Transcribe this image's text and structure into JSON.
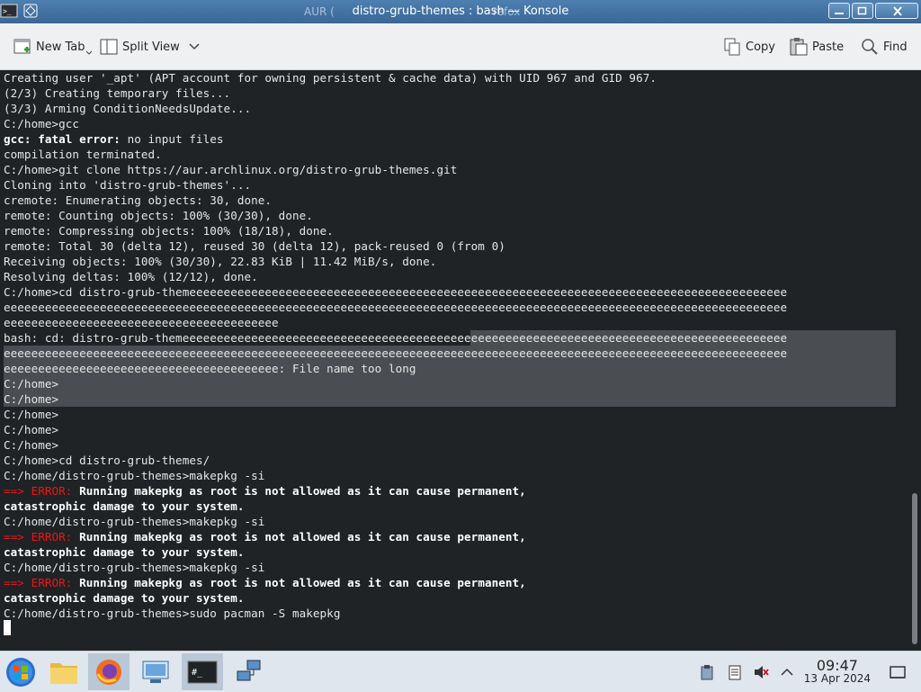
{
  "window": {
    "title": "distro-grub-themes : bash — Konsole",
    "ghost_title_left": "AUR (",
    "ghost_title_right": "refox"
  },
  "toolbar": {
    "new_tab": "New Tab",
    "split_view": "Split View",
    "copy": "Copy",
    "paste": "Paste",
    "find": "Find"
  },
  "terminal": {
    "l01": "Creating user '_apt' (APT account for owning persistent & cache data) with UID 967 and GID 967.",
    "l02": "(2/3) Creating temporary files...",
    "l03": "(3/3) Arming ConditionNeedsUpdate...",
    "l04": "C:/home>gcc",
    "l05_a": "gcc:",
    "l05_b": " fatal error:",
    "l05_c": " no input files",
    "l06": "compilation terminated.",
    "l07": "C:/home>git clone https://aur.archlinux.org/distro-grub-themes.git",
    "l08": "Cloning into 'distro-grub-themes'...",
    "l09": "cremote: Enumerating objects: 30, done.",
    "l10": "remote: Counting objects: 100% (30/30), done.",
    "l11": "remote: Compressing objects: 100% (18/18), done.",
    "l12": "remote: Total 30 (delta 12), reused 30 (delta 12), pack-reused 0 (from 0)",
    "l13": "Receiving objects: 100% (30/30), 22.83 KiB | 11.42 MiB/s, done.",
    "l14": "Resolving deltas: 100% (12/12), done.",
    "l15": "C:/home>cd distro-grub-themeeeeeeeeeeeeeeeeeeeeeeeeeeeeeeeeeeeeeeeeeeeeeeeeeeeeeeeeeeeeeeeeeeeeeeeeeeeeeeeeeeeeeee",
    "l16": "eeeeeeeeeeeeeeeeeeeeeeeeeeeeeeeeeeeeeeeeeeeeeeeeeeeeeeeeeeeeeeeeeeeeeeeeeeeeeeeeeeeeeeeeeeeeeeeeeeeeeeeeeeeeeeeeee",
    "l17": "eeeeeeeeeeeeeeeeeeeeeeeeeeeeeeeeeeeeeeee",
    "l18": "bash: cd: distro-grub-themeeeeeeeeeeeeeeeeeeeeeeeeeeeeeeeeeeeeeeeeeeeeeeeeeeeeeeeeeeeeeeeeeeeeeeeeeeeeeeeeeeeeeeee",
    "l19": "eeeeeeeeeeeeeeeeeeeeeeeeeeeeeeeeeeeeeeeeeeeeeeeeeeeeeeeeeeeeeeeeeeeeeeeeeeeeeeeeeeeeeeeeeeeeeeeeeeeeeeeeeeeeeeeeee",
    "l20": "eeeeeeeeeeeeeeeeeeeeeeeeeeeeeeeeeeeeeeee: File name too long",
    "l21": "C:/home>",
    "l22": "C:/home>",
    "l23": "C:/home>",
    "l24": "C:/home>",
    "l25": "C:/home>",
    "l26": "C:/home>cd distro-grub-themes/",
    "l27": "C:/home/distro-grub-themes>makepkg -si",
    "err_arrow": "==>",
    "err_label": " ERROR:",
    "err_msg": " Running makepkg as root is not allowed as it can cause permanent,",
    "err_msg2": "catastrophic damage to your system.",
    "l30": "C:/home/distro-grub-themes>makepkg -si",
    "l33": "C:/home/distro-grub-themes>makepkg -si",
    "l36": "C:/home/distro-grub-themes>sudo pacman -S makepkg"
  },
  "taskbar": {
    "time": "09:47",
    "date": "13 Apr 2024"
  },
  "icons": [
    "konsole-icon",
    "pin-icon",
    "minimize-icon",
    "maximize-icon",
    "close-icon",
    "new-tab-icon",
    "split-view-icon",
    "chevron-down-icon",
    "copy-icon",
    "paste-icon",
    "find-icon",
    "start-icon",
    "file-manager-icon",
    "firefox-icon",
    "system-settings-icon",
    "terminal-icon",
    "network-icon",
    "clipboard-icon",
    "notes-icon",
    "volume-muted-icon",
    "tray-expand-icon",
    "show-desktop-icon"
  ],
  "colors": {
    "accent": "#3d7ab0",
    "terminal_bg": "#1f2326",
    "error_red": "#ed1515",
    "selection": "#4a4e52"
  }
}
